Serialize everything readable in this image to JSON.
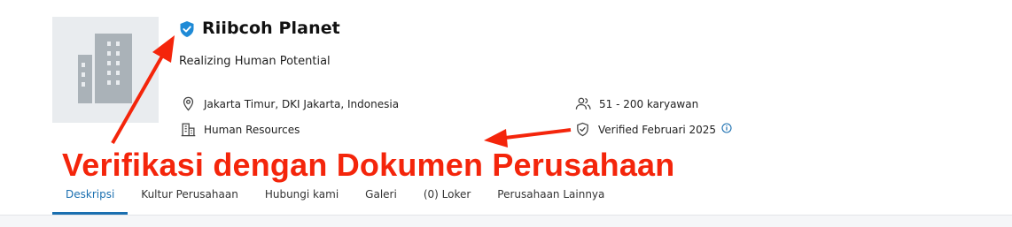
{
  "company": {
    "name": "Riibcoh Planet",
    "tagline": "Realizing Human Potential",
    "logo_icon": "building-icon",
    "badge_icon": "verified-shield-icon"
  },
  "details": {
    "location": {
      "icon": "map-pin-icon",
      "text": "Jakarta Timur, DKI Jakarta, Indonesia"
    },
    "industry": {
      "icon": "office-building-icon",
      "text": "Human Resources"
    },
    "employees": {
      "icon": "users-icon",
      "text": "51 - 200 karyawan"
    },
    "verified": {
      "icon": "shield-check-icon",
      "text": "Verified Februari 2025",
      "info_icon": "info-icon"
    }
  },
  "annotation": {
    "text": "Verifikasi dengan Dokumen Perusahaan",
    "color": "#f4250b"
  },
  "tabs": [
    {
      "label": "Deskripsi",
      "active": true
    },
    {
      "label": "Kultur Perusahaan",
      "active": false
    },
    {
      "label": "Hubungi kami",
      "active": false
    },
    {
      "label": "Galeri",
      "active": false
    },
    {
      "label": "(0) Loker",
      "active": false
    },
    {
      "label": "Perusahaan Lainnya",
      "active": false
    }
  ],
  "colors": {
    "accent": "#1a6fb0",
    "badge": "#1f8ad6",
    "logo_bg": "#e9ecef"
  }
}
